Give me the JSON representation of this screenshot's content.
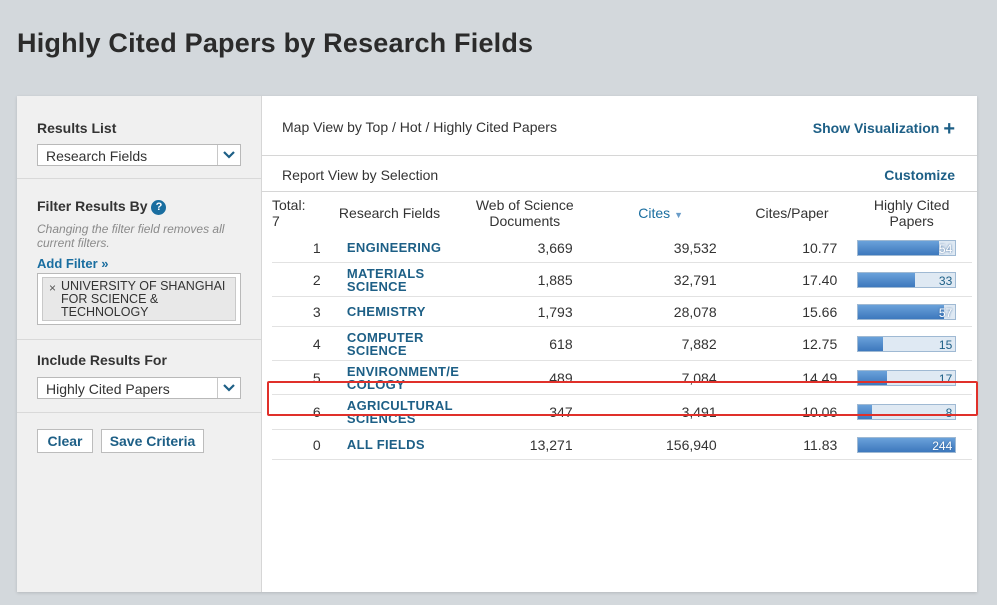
{
  "page": {
    "title": "Highly Cited Papers by Research Fields"
  },
  "sidebar": {
    "results_list_label": "Results List",
    "results_list_value": "Research Fields",
    "filter_label": "Filter Results By",
    "filter_hint": "Changing the filter field removes all current filters.",
    "add_filter": "Add Filter »",
    "filter_chip": "UNIVERSITY OF SHANGHAI FOR SCIENCE & TECHNOLOGY",
    "include_label": "Include Results For",
    "include_value": "Highly Cited Papers",
    "clear_button": "Clear",
    "save_button": "Save Criteria"
  },
  "main": {
    "map_view_text": "Map View by Top / Hot / Highly Cited Papers",
    "show_visualization": "Show Visualization",
    "report_view_text": "Report View by Selection",
    "customize": "Customize",
    "columns": {
      "total": "Total:",
      "total_value": "7",
      "field": "Research Fields",
      "docs": "Web of Science Documents",
      "cites": "Cites",
      "cites_per_paper": "Cites/Paper",
      "hcp": "Highly Cited Papers"
    },
    "rows": [
      {
        "rank": "1",
        "field_line1": "ENGINEERING",
        "field_line2": "",
        "docs": "3,669",
        "cites": "39,532",
        "cpp": "10.77",
        "hcp": "54",
        "hcp_fraction": 0.83
      },
      {
        "rank": "2",
        "field_line1": "MATERIALS",
        "field_line2": "SCIENCE",
        "docs": "1,885",
        "cites": "32,791",
        "cpp": "17.40",
        "hcp": "33",
        "hcp_fraction": 0.58
      },
      {
        "rank": "3",
        "field_line1": "CHEMISTRY",
        "field_line2": "",
        "docs": "1,793",
        "cites": "28,078",
        "cpp": "15.66",
        "hcp": "57",
        "hcp_fraction": 0.88
      },
      {
        "rank": "4",
        "field_line1": "COMPUTER",
        "field_line2": "SCIENCE",
        "docs": "618",
        "cites": "7,882",
        "cpp": "12.75",
        "hcp": "15",
        "hcp_fraction": 0.26
      },
      {
        "rank": "5",
        "field_line1": "ENVIRONMENT/E",
        "field_line2": "COLOGY",
        "docs": "489",
        "cites": "7,084",
        "cpp": "14.49",
        "hcp": "17",
        "hcp_fraction": 0.3
      },
      {
        "rank": "6",
        "field_line1": "AGRICULTURAL",
        "field_line2": "SCIENCES",
        "docs": "347",
        "cites": "3,491",
        "cpp": "10.06",
        "hcp": "8",
        "hcp_fraction": 0.14
      },
      {
        "rank": "0",
        "field_line1": "ALL FIELDS",
        "field_line2": "",
        "docs": "13,271",
        "cites": "156,940",
        "cpp": "11.83",
        "hcp": "244",
        "hcp_fraction": 1.0
      }
    ],
    "highlighted_row": "6"
  },
  "colors": {
    "link": "#1d5f86",
    "highlight": "#e0302a",
    "bar": "#3d78bd"
  }
}
